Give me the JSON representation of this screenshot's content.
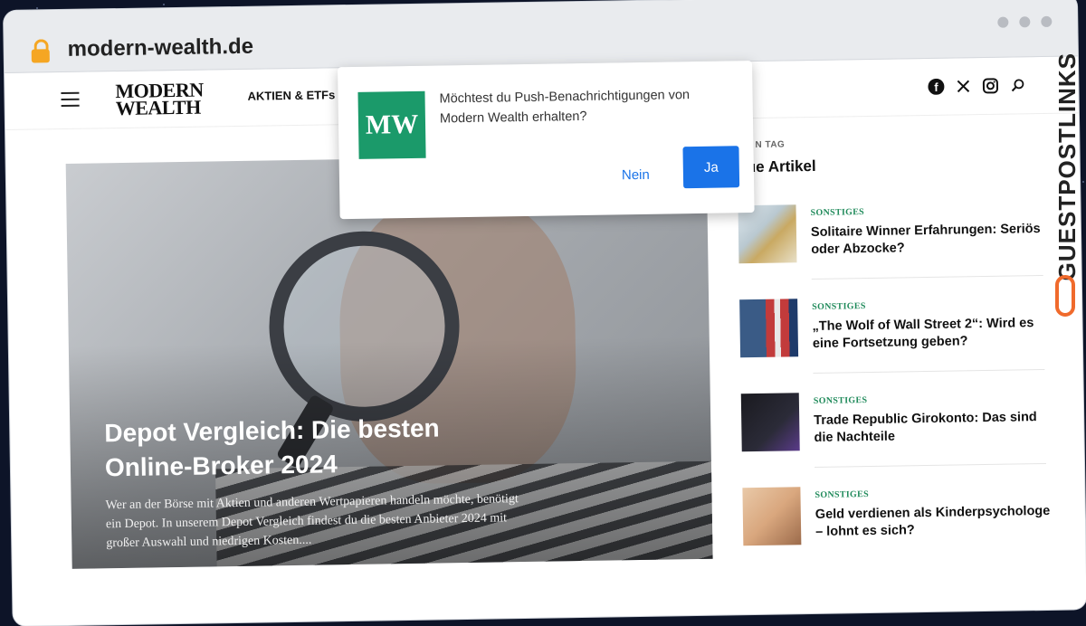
{
  "browser": {
    "url": "modern-wealth.de"
  },
  "header": {
    "logo_line1": "MODERN",
    "logo_line2": "WEALTH",
    "nav_item": "AKTIEN & ETFs",
    "social_icons": [
      "facebook-icon",
      "x-icon",
      "instagram-icon",
      "search-icon"
    ]
  },
  "hero": {
    "title": "Depot Vergleich: Die besten Online-Broker 2024",
    "excerpt": "Wer an der Börse mit Aktien und anderen Wertpapieren handeln möchte, benötigt ein Depot. In unserem Depot Vergleich findest du die besten Anbieter 2024 mit großer Auswahl und niedrigen Kosten...."
  },
  "sidebar": {
    "tag": "N TAG",
    "heading": "ue Artikel",
    "articles": [
      {
        "category": "SONSTIGES",
        "title": "Solitaire Winner Erfahrungen: Seriös oder Abzocke?"
      },
      {
        "category": "SONSTIGES",
        "title": "„The Wolf of Wall Street 2“: Wird es eine Fortsetzung geben?"
      },
      {
        "category": "SONSTIGES",
        "title": "Trade Republic Girokonto: Das sind die Nachteile"
      },
      {
        "category": "SONSTIGES",
        "title": "Geld verdienen als Kinderpsychologe – lohnt es sich?"
      }
    ]
  },
  "popup": {
    "logo": "MW",
    "message": "Möchtest du Push-Benachrichtigungen von Modern Wealth erhalten?",
    "no_label": "Nein",
    "yes_label": "Ja"
  },
  "watermark": {
    "text": "GUESTPOSTLINKS"
  },
  "colors": {
    "accent": "#1a73e8",
    "brand_green": "#1b9a6a",
    "category_green": "#1f8a5a",
    "lock": "#f5a623",
    "watermark_icon": "#f06a2c"
  }
}
